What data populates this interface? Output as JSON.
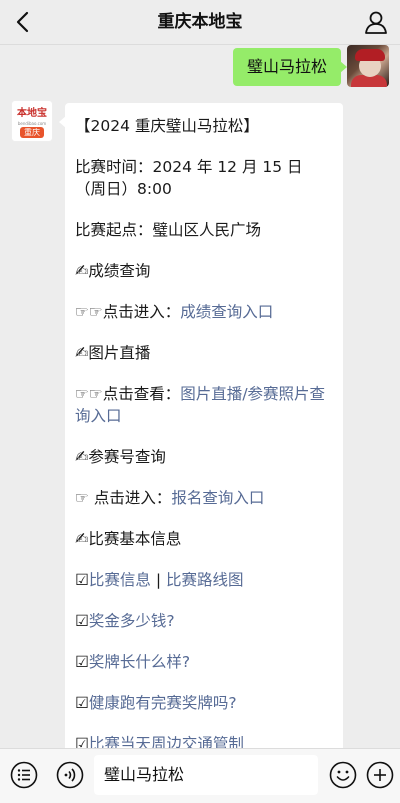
{
  "header": {
    "title": "重庆本地宝"
  },
  "user_message": "璧山马拉松",
  "bot_logo": {
    "brand": "本地宝",
    "url": "bendibao.com",
    "city": "重庆"
  },
  "bot_message": {
    "title": "【2024 重庆璧山马拉松】",
    "time_label": "比赛时间：",
    "time_value": "2024 年 12 月 15 日（周日）8:00",
    "start_label": "比赛起点：",
    "start_value": "璧山区人民广场",
    "sections": {
      "results": {
        "emoji": "✍",
        "title": "成绩查询",
        "action_prefix": "☞☞点击进入：",
        "link": "成绩查询入口"
      },
      "photos": {
        "emoji": "✍",
        "title": "图片直播",
        "action_prefix": "☞☞点击查看：",
        "link1": "图片直播",
        "sep": "/",
        "link2": "参赛照片查询入口"
      },
      "bib": {
        "emoji": "✍",
        "title": "参赛号查询",
        "action_prefix": "☞ 点击进入：",
        "link": "报名查询入口"
      },
      "basic": {
        "emoji": "✍",
        "title": "比赛基本信息",
        "items": [
          {
            "box": "☑",
            "parts": [
              {
                "text": "比赛信息",
                "link": true
              },
              {
                "text": " | ",
                "link": false
              },
              {
                "text": "比赛路线图",
                "link": true
              }
            ]
          },
          {
            "box": "☑",
            "parts": [
              {
                "text": "奖金多少钱?",
                "link": true
              }
            ]
          },
          {
            "box": "☑",
            "parts": [
              {
                "text": "奖牌长什么样?",
                "link": true
              }
            ]
          },
          {
            "box": "☑",
            "parts": [
              {
                "text": "健康跑有完赛奖牌吗?",
                "link": true
              }
            ]
          },
          {
            "box": "☑",
            "parts": [
              {
                "text": "比赛当天周边交通管制",
                "link": true
              }
            ]
          }
        ]
      }
    }
  },
  "input_bar": {
    "value": "璧山马拉松"
  },
  "icons": {
    "back": "chevron-left-icon",
    "profile": "person-icon",
    "list": "list-icon",
    "voice": "voice-icon",
    "emoji": "emoji-icon",
    "add": "plus-icon"
  },
  "colors": {
    "bubble_user": "#95ec69",
    "link": "#576b95",
    "background": "#ededed"
  }
}
